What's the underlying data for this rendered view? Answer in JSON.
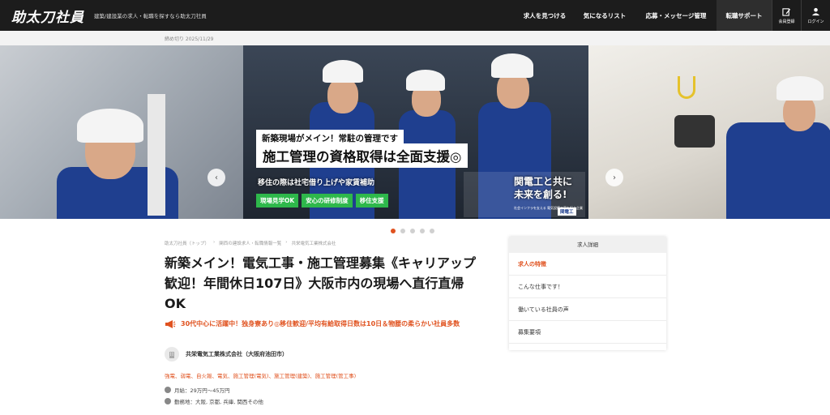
{
  "header": {
    "logo": "助太刀社員",
    "tagline": "建築/建設業の求人・転職を探すなら助太刀社員",
    "nav": [
      "求人を見つける",
      "気になるリスト",
      "応募・メッセージ管理",
      "転職サポート"
    ],
    "register_label": "会員登録",
    "login_label": "ログイン"
  },
  "deadline": "締め切り 2025/11/29",
  "carousel": {
    "copy1": "新築現場がメイン！常駐の管理です",
    "copy2": "施工管理の資格取得は全面支援◎",
    "copy3": "移住の際は社宅借り上げや家賃補助",
    "tags": [
      "現場見学OK",
      "安心の研修制度",
      "移住支援"
    ],
    "kanden_line1": "関電工と共に",
    "kanden_line2": "未来を創る!",
    "kanden_small": "社会インフラを支える 電気設備工事を担う企業",
    "kanden_logo": "関電工",
    "dots": 5,
    "active_dot": 0
  },
  "breadcrumb": [
    "助太刀社員（トップ）",
    "›",
    "関西の建設求人・転職情報一覧",
    "›",
    "共栄電気工業株式会社"
  ],
  "job": {
    "title": "新築メイン！電気工事・施工管理募集《キャリアップ歓迎！年間休日107日》大阪市内の現場へ直行直帰OK",
    "catch": "30代中心に活躍中！独身寮あり◎移住歓迎/平均有給取得日数は10日＆物腰の柔らかい社員多数",
    "company": "共栄電気工業株式会社（大阪府池田市）",
    "categories": "強電、弱電、自火報、電気、施工管理(電気)、施工管理(建築)、施工管理(管工事)",
    "salary": "月給：29万円〜45万円",
    "location": "勤務地：大阪, 京都, 兵庫, 関西その他"
  },
  "panel": {
    "title": "求人詳細",
    "items": [
      "求人の特徴",
      "こんな仕事です！",
      "働いている社員の声",
      "募集要項"
    ]
  }
}
